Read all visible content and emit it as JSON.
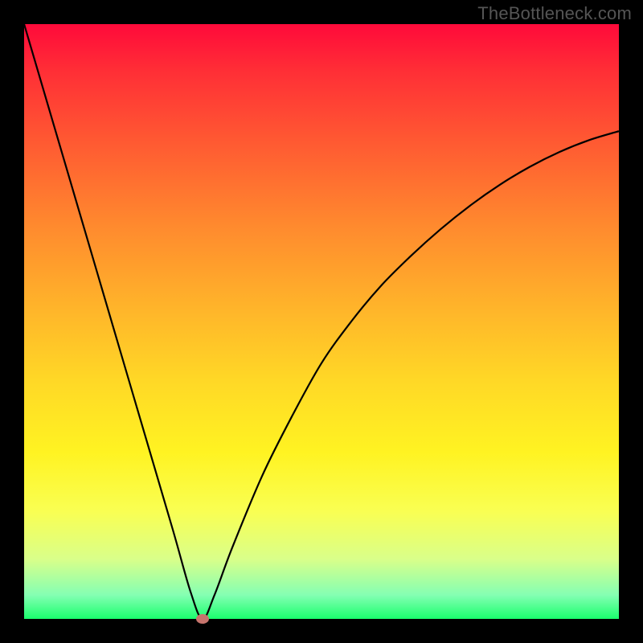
{
  "watermark": "TheBottleneck.com",
  "chart_data": {
    "type": "line",
    "title": "",
    "xlabel": "",
    "ylabel": "",
    "xlim": [
      0,
      100
    ],
    "ylim": [
      0,
      100
    ],
    "grid": false,
    "legend": false,
    "series": [
      {
        "name": "bottleneck-curve",
        "x": [
          0,
          5,
          10,
          15,
          20,
          25,
          28,
          30,
          32,
          35,
          40,
          45,
          50,
          55,
          60,
          65,
          70,
          75,
          80,
          85,
          90,
          95,
          100
        ],
        "values": [
          100,
          83,
          66,
          49,
          32,
          15,
          4.5,
          0,
          4,
          12,
          24,
          34,
          43,
          50,
          56,
          61,
          65.5,
          69.5,
          73,
          76,
          78.5,
          80.5,
          82
        ]
      }
    ],
    "annotations": [
      {
        "name": "optimal-point",
        "x": 30,
        "y": 0
      }
    ],
    "background_gradient": {
      "top": "#ff0a3a",
      "bottom": "#1aff6d"
    }
  }
}
